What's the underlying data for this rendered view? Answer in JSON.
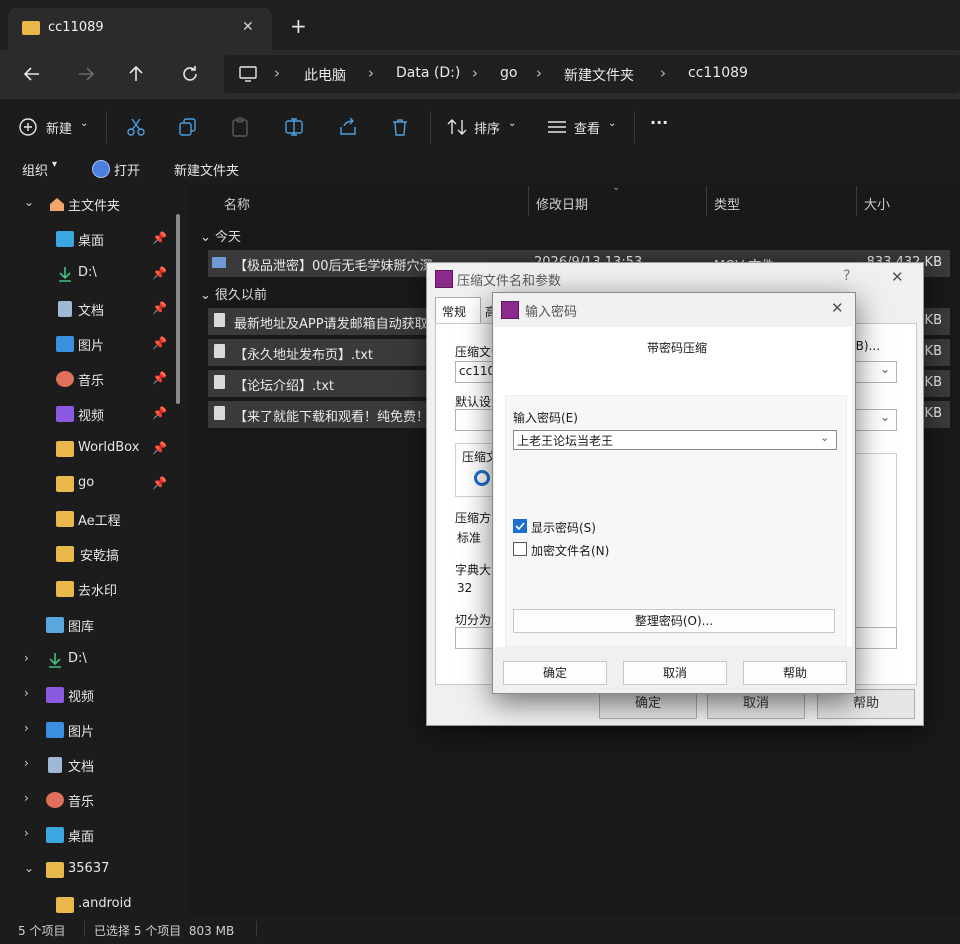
{
  "window": {
    "tab_title": "cc11089",
    "new_tab": "+",
    "close_tab": "✕"
  },
  "breadcrumb": {
    "items": [
      "此电脑",
      "Data (D:)",
      "go",
      "新建文件夹",
      "cc11089"
    ]
  },
  "toolbar": {
    "new_label": "新建",
    "sort_label": "排序",
    "view_label": "查看",
    "more_label": "···"
  },
  "subbar": {
    "organize_label": "组织",
    "open_label": "打开",
    "new_folder_label": "新建文件夹"
  },
  "nav_pane": {
    "items": [
      {
        "label": "主文件夹",
        "icon": "home-icon",
        "pinned": false
      },
      {
        "label": "桌面",
        "icon": "desktop-icon",
        "pinned": true
      },
      {
        "label": "D:\\",
        "icon": "download-icon",
        "pinned": true
      },
      {
        "label": "文档",
        "icon": "document-icon",
        "pinned": true
      },
      {
        "label": "图片",
        "icon": "pictures-icon",
        "pinned": true
      },
      {
        "label": "音乐",
        "icon": "music-icon",
        "pinned": true
      },
      {
        "label": "视频",
        "icon": "video-icon",
        "pinned": true
      },
      {
        "label": "WorldBox",
        "icon": "folder-icon",
        "pinned": true
      },
      {
        "label": "go",
        "icon": "folder-icon",
        "pinned": true
      },
      {
        "label": "Ae工程",
        "icon": "folder-icon",
        "pinned": false
      },
      {
        "label": "安乾搞",
        "icon": "folder-icon",
        "pinned": false
      },
      {
        "label": "去水印",
        "icon": "folder-icon",
        "pinned": false
      },
      {
        "label": "图库",
        "icon": "gallery-icon",
        "pinned": false
      },
      {
        "label": "D:\\",
        "icon": "download-icon",
        "pinned": false
      },
      {
        "label": "视频",
        "icon": "video-icon",
        "pinned": false
      },
      {
        "label": "图片",
        "icon": "pictures-icon",
        "pinned": false
      },
      {
        "label": "文档",
        "icon": "document-icon",
        "pinned": false
      },
      {
        "label": "音乐",
        "icon": "music-icon",
        "pinned": false
      },
      {
        "label": "桌面",
        "icon": "desktop-icon",
        "pinned": false
      },
      {
        "label": "35637",
        "icon": "folder-icon",
        "pinned": false
      },
      {
        "label": ".android",
        "icon": "folder-icon",
        "pinned": false
      }
    ]
  },
  "file_list": {
    "columns": [
      "名称",
      "修改日期",
      "类型",
      "大小"
    ],
    "groups": {
      "today": "今天",
      "long_ago": "很久以前"
    },
    "files": [
      {
        "name": "【极品泄密】00后无毛学妹掰穴深",
        "date": "2026/9/13 13:53",
        "type": "MOV 文件",
        "size": "833,432 KB"
      },
      {
        "name": "最新地址及APP请发邮箱自动获取",
        "size": "KB"
      },
      {
        "name": "【永久地址发布页】.txt",
        "size": "KB"
      },
      {
        "name": "【论坛介绍】.txt",
        "size": "KB"
      },
      {
        "name": "【来了就能下载和观看！纯免费！",
        "size": "KB"
      }
    ]
  },
  "status_bar": {
    "count": "5 个项目",
    "selected": "已选择 5 个项目  803 MB"
  },
  "archive_dialog": {
    "title": "压缩文件名和参数",
    "help": "?",
    "close": "✕",
    "tabs": [
      "常规",
      "高级"
    ],
    "archive_name_label": "压缩文件",
    "browse_label": "(B)...",
    "archive_name_value": "cc1108",
    "profile_label": "默认设置",
    "format_label": "压缩文",
    "method_label": "压缩方",
    "method_value": "标准",
    "dict_label": "字典大",
    "dict_value": "32",
    "split_label": "切分为",
    "ok": "确定",
    "cancel": "取消",
    "help_btn": "帮助"
  },
  "password_dialog": {
    "title": "输入密码",
    "close": "✕",
    "heading": "带密码压缩",
    "password_label": "输入密码(E)",
    "password_value": "上老王论坛当老王",
    "show_password": "显示密码(S)",
    "show_password_checked": true,
    "encrypt_names": "加密文件名(N)",
    "encrypt_names_checked": false,
    "manage_label": "整理密码(O)...",
    "ok": "确定",
    "cancel": "取消",
    "help": "帮助"
  },
  "colors": {
    "accent": "#4a9fe0",
    "folder": "#e8b84a",
    "selected_row": "#3a3a3a"
  }
}
